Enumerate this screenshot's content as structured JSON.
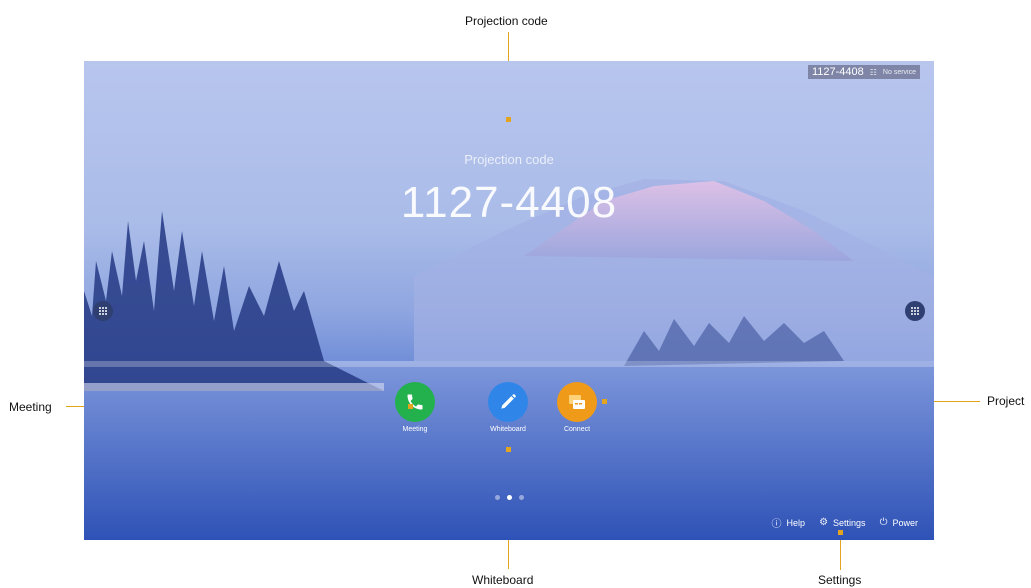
{
  "annotations": {
    "projection_code": "Projection code",
    "meeting": "Meeting",
    "project": "Project",
    "whiteboard": "Whiteboard",
    "settings": "Settings"
  },
  "status_bar": {
    "code": "1127-4408",
    "wifi_icon": "wifi-icon",
    "network": "No service"
  },
  "projection": {
    "label": "Projection code",
    "code": "1127-4408"
  },
  "apps": [
    {
      "label": "Meeting",
      "icon": "phone-icon",
      "color": "#22b14c"
    },
    {
      "label": "Whiteboard",
      "icon": "pen-icon",
      "color": "#2f86e8"
    },
    {
      "label": "Connect",
      "icon": "connect-icon",
      "color": "#f09a19"
    }
  ],
  "pager": {
    "pages": 3,
    "active": 2
  },
  "bottom_bar": {
    "help": "Help",
    "settings": "Settings",
    "power": "Power"
  },
  "colors": {
    "annotation_line": "#e3a520"
  }
}
